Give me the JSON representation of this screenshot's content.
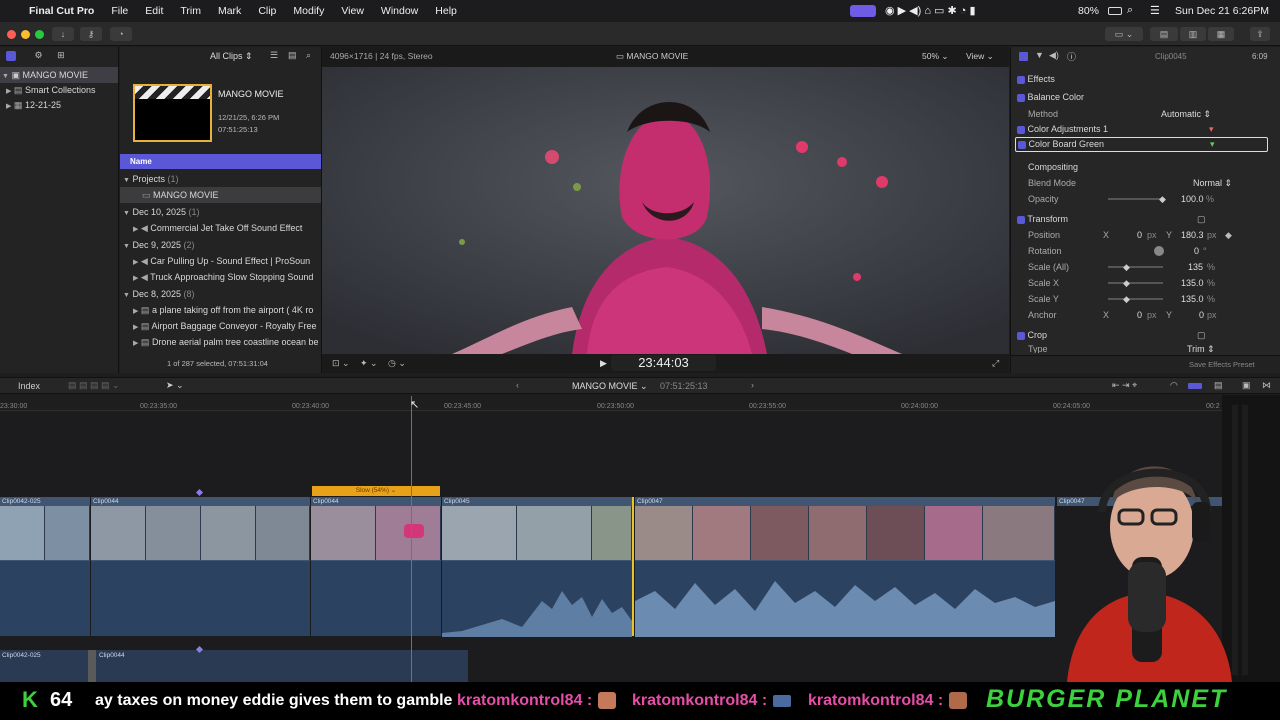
{
  "menubar": {
    "app": "Final Cut Pro",
    "items": [
      "File",
      "Edit",
      "Trim",
      "Mark",
      "Clip",
      "Modify",
      "View",
      "Window",
      "Help"
    ],
    "battery": "80%",
    "clock": "Sun Dec 21  6:26PM"
  },
  "libraries": {
    "items": [
      {
        "label": "MANGO MOVIE"
      },
      {
        "label": "Smart Collections"
      },
      {
        "label": "12-21-25"
      }
    ]
  },
  "browser": {
    "filter": "All Clips",
    "project_title": "MANGO MOVIE",
    "project_date": "12/21/25, 6:26 PM",
    "project_duration": "07:51:25:13",
    "column_name": "Name",
    "groups": [
      {
        "label": "Projects",
        "count": "(1)",
        "items": [
          "MANGO MOVIE"
        ]
      },
      {
        "label": "Dec 10, 2025",
        "count": "(1)",
        "items": [
          "Commercial Jet Take Off Sound Effect"
        ]
      },
      {
        "label": "Dec 9, 2025",
        "count": "(2)",
        "items": [
          "Car Pulling Up - Sound Effect  |  ProSoun",
          "Truck Approaching Slow Stopping Sound"
        ]
      },
      {
        "label": "Dec 8, 2025",
        "count": "(8)",
        "items": [
          "a plane taking off from the airport ( 4K ro",
          "Airport Baggage Conveyor - Royalty Free",
          "Drone aerial palm tree coastline ocean be"
        ]
      }
    ],
    "status": "1 of 287 selected, 07:51:31:04"
  },
  "viewer": {
    "format": "4096×1716 | 24 fps, Stereo",
    "title": "MANGO MOVIE",
    "zoom": "50%",
    "view_label": "View",
    "timecode": "23:44:03"
  },
  "inspector": {
    "clip_name": "Clip0045",
    "duration": "6:09",
    "effects_header": "Effects",
    "balance_color": "Balance Color",
    "method_label": "Method",
    "method_value": "Automatic",
    "color_adj": "Color Adjustments 1",
    "color_board": "Color Board Green",
    "compositing": "Compositing",
    "blend_label": "Blend Mode",
    "blend_value": "Normal",
    "opacity_label": "Opacity",
    "opacity_value": "100.0",
    "opacity_unit": "%",
    "transform": "Transform",
    "position_label": "Position",
    "pos_x_label": "X",
    "pos_x": "0",
    "pos_y_label": "Y",
    "pos_y": "180.3",
    "px": "px",
    "rotation_label": "Rotation",
    "rotation_value": "0",
    "deg": "°",
    "scale_all_label": "Scale (All)",
    "scale_all": "135",
    "scale_x_label": "Scale X",
    "scale_x": "135.0",
    "scale_y_label": "Scale Y",
    "scale_y": "135.0",
    "anchor_label": "Anchor",
    "anchor_x": "0",
    "anchor_y": "0",
    "crop": "Crop",
    "type_label": "Type",
    "type_value": "Trim",
    "save_preset": "Save Effects Preset"
  },
  "timeline": {
    "index_label": "Index",
    "project": "MANGO MOVIE",
    "duration": "07:51:25:13",
    "ticks": [
      "23:30:00",
      "00:23:35:00",
      "00:23:40:00",
      "00:23:45:00",
      "00:23:50:00",
      "00:23:55:00",
      "00:24:00:00",
      "00:24:05:00",
      "00:2"
    ],
    "retime_label": "Slow (54%)",
    "clips": [
      "Clip0042-025",
      "Clip0044",
      "Clip0044",
      "Clip0045",
      "Clip0047",
      "Clip0047"
    ],
    "lower_clips": [
      "Clip0042-025",
      "Clip0044"
    ]
  },
  "stream": {
    "k_label": "K",
    "k_count": "64",
    "ticker": "ay taxes on money eddie gives them to gamble",
    "user1": "kratomkontrol84 :",
    "user2": "kratomkontrol84 :",
    "user3": "kratomkontrol84 :",
    "brand": "BURGER PLANET"
  },
  "colors": {
    "accent": "#5a58d6",
    "retime": "#e8a21a",
    "playhead": "#e0453a",
    "clip_video": "#546a84",
    "clip_audio": "#2b4261"
  }
}
